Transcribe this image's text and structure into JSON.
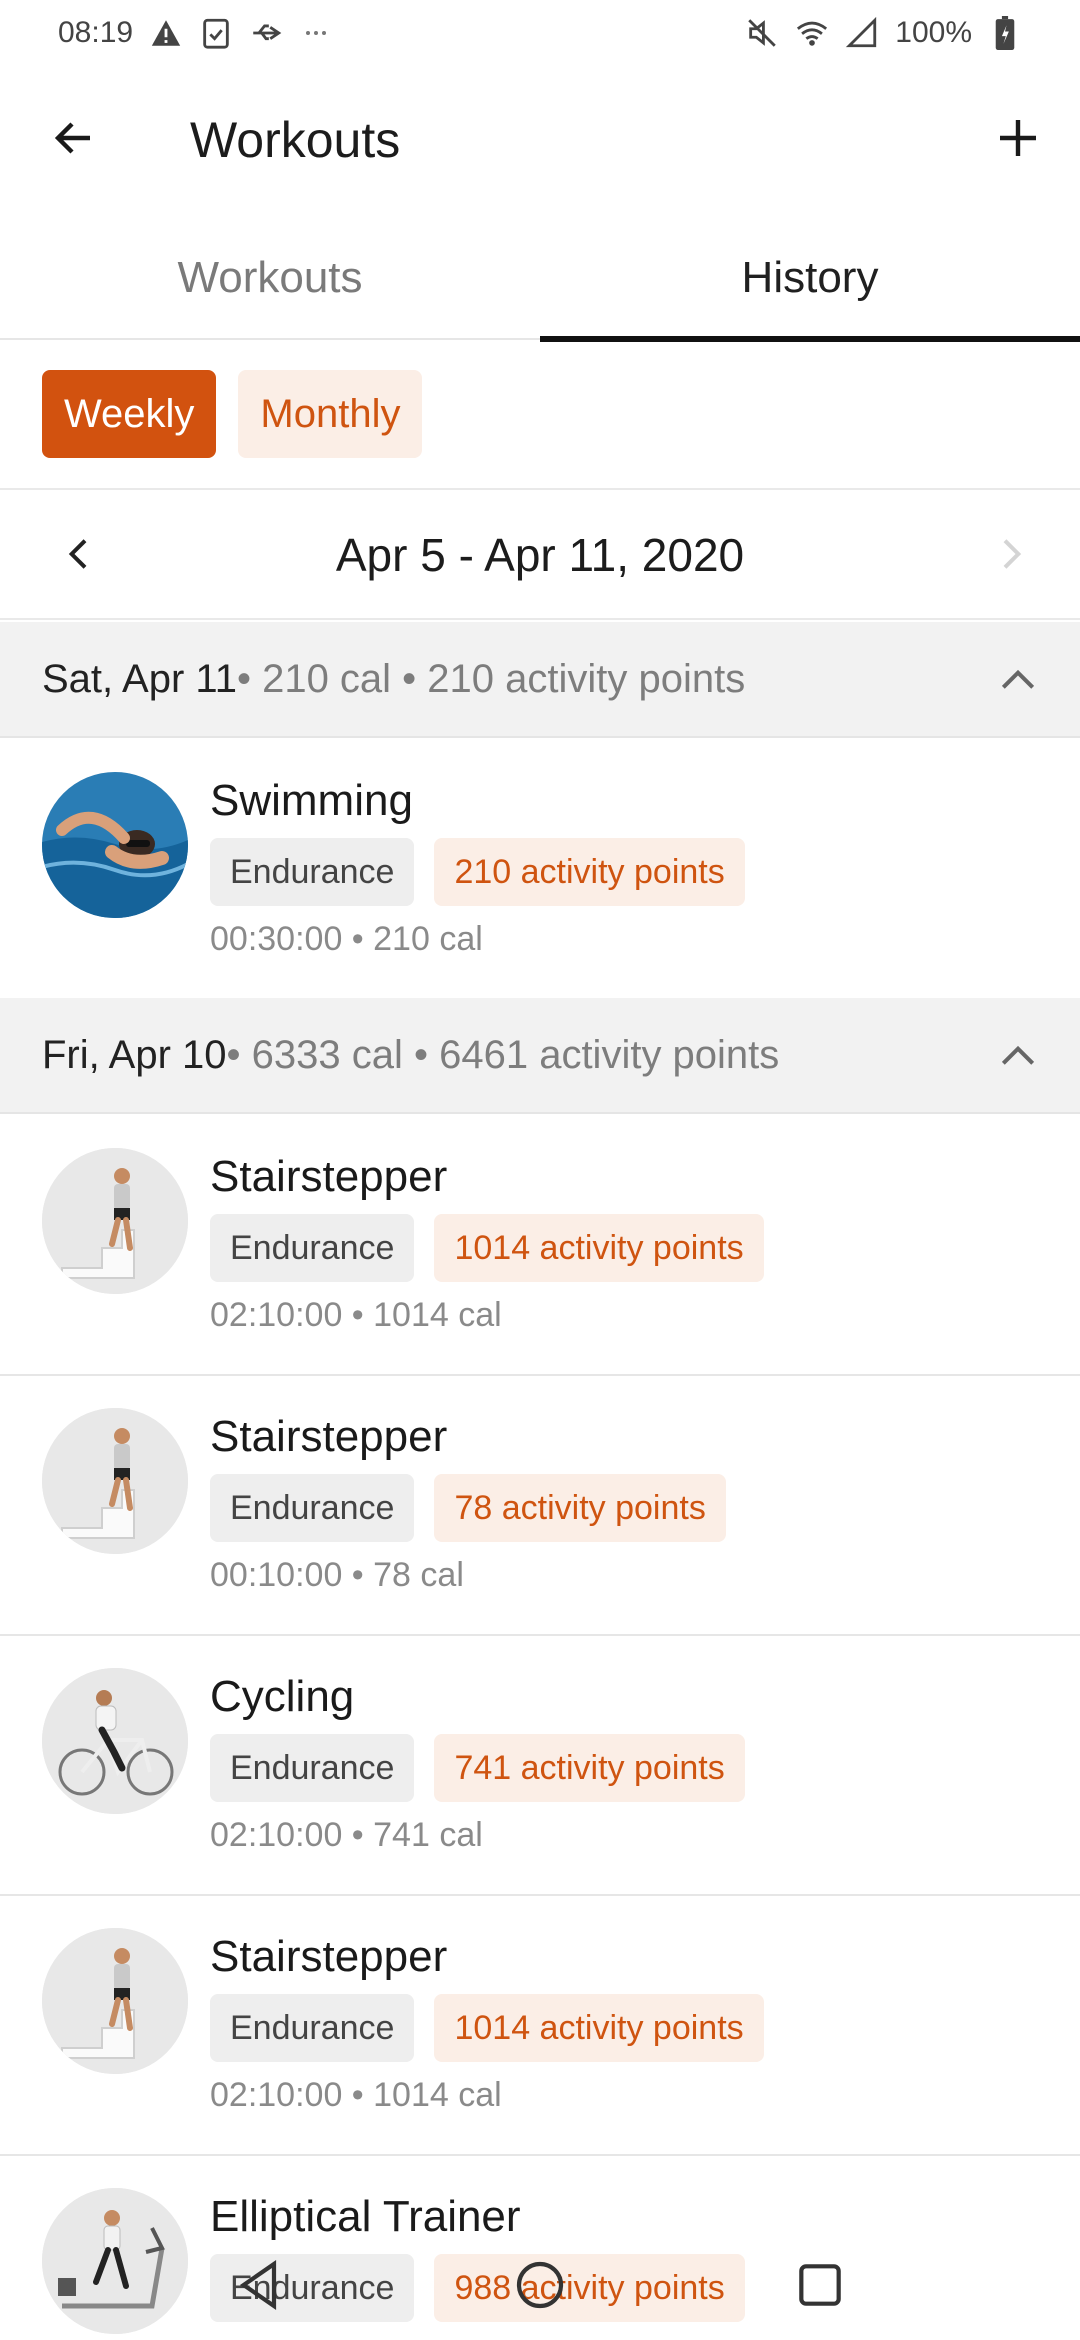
{
  "status": {
    "time": "08:19",
    "battery": "100%",
    "left_icons": [
      "warning-icon",
      "clipboard-check-icon",
      "usb-icon",
      "more-icon"
    ],
    "right_icons": [
      "mute-icon",
      "wifi-icon",
      "signal-icon",
      "battery-icon"
    ]
  },
  "app_bar": {
    "title": "Workouts"
  },
  "tabs": [
    {
      "label": "Workouts",
      "active": false
    },
    {
      "label": "History",
      "active": true
    }
  ],
  "range_filter": {
    "weekly": "Weekly",
    "monthly": "Monthly",
    "selected": "Weekly"
  },
  "date_nav": {
    "label": "Apr 5 - Apr 11, 2020"
  },
  "days": [
    {
      "date": "Sat, Apr 11",
      "meta": " • 210 cal • 210 activity points",
      "workouts": [
        {
          "name": "Swimming",
          "category": "Endurance",
          "points": "210 activity points",
          "meta": "00:30:00 • 210 cal",
          "icon": "swimmer-image"
        }
      ]
    },
    {
      "date": "Fri, Apr 10",
      "meta": " • 6333 cal • 6461 activity points",
      "workouts": [
        {
          "name": "Stairstepper",
          "category": "Endurance",
          "points": "1014 activity points",
          "meta": "02:10:00 • 1014 cal",
          "icon": "stairstepper-image"
        },
        {
          "name": "Stairstepper",
          "category": "Endurance",
          "points": "78 activity points",
          "meta": "00:10:00 • 78 cal",
          "icon": "stairstepper-image"
        },
        {
          "name": "Cycling",
          "category": "Endurance",
          "points": "741 activity points",
          "meta": "02:10:00 • 741 cal",
          "icon": "cyclist-image"
        },
        {
          "name": "Stairstepper",
          "category": "Endurance",
          "points": "1014 activity points",
          "meta": "02:10:00 • 1014 cal",
          "icon": "stairstepper-image"
        },
        {
          "name": "Elliptical Trainer",
          "category": "Endurance",
          "points": "988 activity points",
          "meta": "",
          "icon": "elliptical-image"
        }
      ]
    }
  ],
  "colors": {
    "accent": "#d2520f",
    "accent_soft": "#fbeee6",
    "header_bg": "#f2f2f2"
  }
}
